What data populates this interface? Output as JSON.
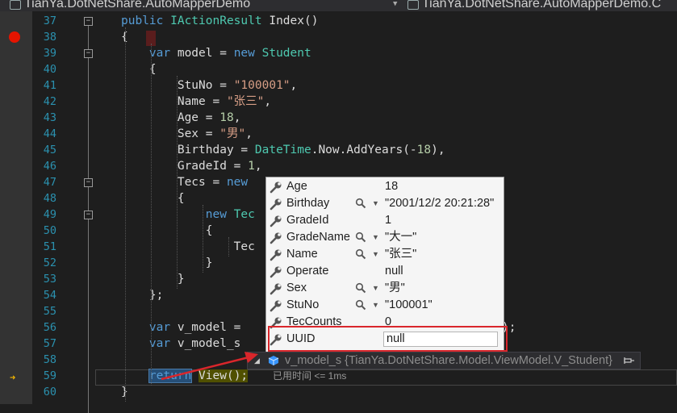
{
  "tabs": [
    {
      "label": "TianYa.DotNetShare.AutoMapperDemo"
    },
    {
      "label": "TianYa.DotNetShare.AutoMapperDemo.C"
    }
  ],
  "code_lines": [
    {
      "num": "37",
      "code": [
        [
          "public ",
          "kw"
        ],
        [
          "IActionResult",
          "ty"
        ],
        [
          " Index()",
          ""
        ]
      ]
    },
    {
      "num": "38",
      "code": [
        [
          "{",
          ""
        ]
      ]
    },
    {
      "num": "39",
      "code": [
        [
          "    var ",
          "kw"
        ],
        [
          "model = ",
          ""
        ],
        [
          "new ",
          "kw"
        ],
        [
          "Student",
          "ty"
        ]
      ]
    },
    {
      "num": "40",
      "code": [
        [
          "    {",
          ""
        ]
      ]
    },
    {
      "num": "41",
      "code": [
        [
          "        StuNo = ",
          ""
        ],
        [
          "\"100001\"",
          "st"
        ],
        [
          ",",
          ""
        ]
      ]
    },
    {
      "num": "42",
      "code": [
        [
          "        Name = ",
          ""
        ],
        [
          "\"张三\"",
          "st"
        ],
        [
          ",",
          ""
        ]
      ]
    },
    {
      "num": "43",
      "code": [
        [
          "        Age = ",
          ""
        ],
        [
          "18",
          "nm"
        ],
        [
          ",",
          ""
        ]
      ]
    },
    {
      "num": "44",
      "code": [
        [
          "        Sex = ",
          ""
        ],
        [
          "\"男\"",
          "st"
        ],
        [
          ",",
          ""
        ]
      ]
    },
    {
      "num": "45",
      "code": [
        [
          "        Birthday = ",
          ""
        ],
        [
          "DateTime",
          "ty"
        ],
        [
          ".Now.AddYears(-",
          ""
        ],
        [
          "18",
          "nm"
        ],
        [
          "),",
          ""
        ]
      ]
    },
    {
      "num": "46",
      "code": [
        [
          "        GradeId = ",
          ""
        ],
        [
          "1",
          "nm"
        ],
        [
          ",",
          ""
        ]
      ]
    },
    {
      "num": "47",
      "code": [
        [
          "        Tecs = ",
          ""
        ],
        [
          "new",
          "kw"
        ]
      ]
    },
    {
      "num": "48",
      "code": [
        [
          "        {",
          ""
        ]
      ]
    },
    {
      "num": "49",
      "code": [
        [
          "            new ",
          "kw"
        ],
        [
          "Tec",
          "ty"
        ]
      ]
    },
    {
      "num": "50",
      "code": [
        [
          "            {",
          ""
        ]
      ]
    },
    {
      "num": "51",
      "code": [
        [
          "                Tec",
          ""
        ]
      ]
    },
    {
      "num": "52",
      "code": [
        [
          "            }",
          ""
        ]
      ]
    },
    {
      "num": "53",
      "code": [
        [
          "        }",
          ""
        ]
      ]
    },
    {
      "num": "54",
      "code": [
        [
          "    };",
          ""
        ]
      ]
    },
    {
      "num": "55",
      "code": []
    },
    {
      "num": "56",
      "code": [
        [
          "    var ",
          "kw"
        ],
        [
          "v_model = ",
          ""
        ]
      ],
      "tail": ");"
    },
    {
      "num": "57",
      "code": [
        [
          "    var ",
          "kw"
        ],
        [
          "v_model_s",
          ""
        ]
      ]
    },
    {
      "num": "58",
      "code": []
    },
    {
      "num": "59",
      "code": [
        [
          "    ",
          ""
        ],
        [
          "return",
          "ret-hl"
        ],
        [
          " ",
          ""
        ],
        [
          "View();",
          "view-hl"
        ]
      ],
      "hint": "已用时间 <= 1ms"
    },
    {
      "num": "60",
      "code": [
        [
          "}",
          ""
        ]
      ]
    }
  ],
  "tooltip_rows": [
    {
      "name": "Age",
      "value": "18",
      "has_viz": false
    },
    {
      "name": "Birthday",
      "value": "\"2001/12/2 20:21:28\"",
      "has_viz": true
    },
    {
      "name": "GradeId",
      "value": "1",
      "has_viz": false
    },
    {
      "name": "GradeName",
      "value": "\"大一\"",
      "has_viz": true
    },
    {
      "name": "Name",
      "value": "\"张三\"",
      "has_viz": true
    },
    {
      "name": "Operate",
      "value": "null",
      "has_viz": false
    },
    {
      "name": "Sex",
      "value": "\"男\"",
      "has_viz": true
    },
    {
      "name": "StuNo",
      "value": "\"100001\"",
      "has_viz": true
    },
    {
      "name": "TecCounts",
      "value": "0",
      "has_viz": false
    },
    {
      "name": "UUID",
      "value": "null",
      "editing": true
    }
  ],
  "datatip": {
    "text": "v_model_s {TianYa.DotNetShare.Model.ViewModel.V_Student}"
  },
  "icons": {
    "property": "wrench-icon",
    "visualizer": "magnifier-icon",
    "object": "cube-icon",
    "pin": "pin-icon",
    "breakpoint": "breakpoint-icon",
    "current": "current-statement-arrow-icon"
  },
  "colors": {
    "editor_bg": "#1e1e1e",
    "keyword": "#569cd6",
    "type": "#4ec9b0",
    "string": "#d69d85",
    "number": "#b5cea8",
    "line_number": "#2b91af",
    "breakpoint": "#e51400",
    "annotation_red": "#d9262b"
  }
}
